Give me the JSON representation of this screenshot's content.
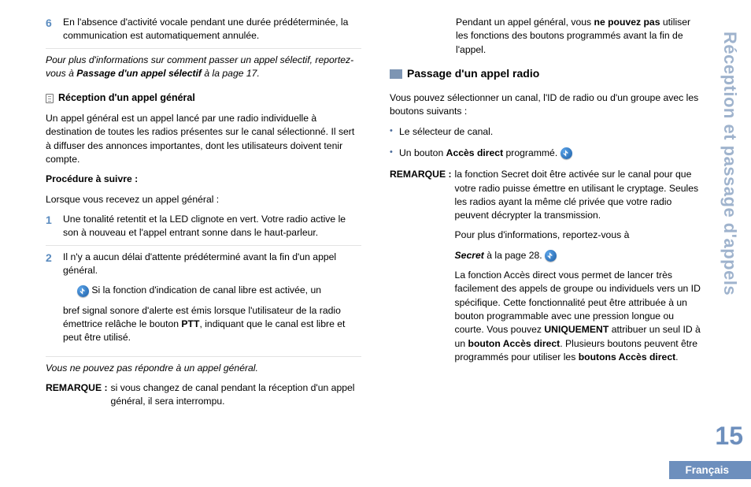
{
  "left": {
    "step6": {
      "num": "6",
      "text": "En l'absence d'activité vocale pendant une durée prédéterminée, la communication est automatiquement annulée."
    },
    "selective_note_pre": "Pour plus d'informations sur comment passer un appel sélectif, reportez-vous à ",
    "selective_note_bold": "Passage d'un appel sélectif",
    "selective_note_post": " à la page 17.",
    "reception_heading": "Réception d'un appel général",
    "reception_para": "Un appel général est un appel lancé par une radio individuelle à destination de toutes les radios présentes sur le canal sélectionné. Il sert à diffuser des annonces importantes, dont les utilisateurs doivent tenir compte.",
    "procedure_label": "Procédure à suivre :",
    "procedure_intro": "Lorsque vous recevez un appel général :",
    "step1": {
      "num": "1",
      "text": "Une tonalité retentit et la LED clignote en vert. Votre radio active le son à nouveau et l'appel entrant sonne dans le haut-parleur."
    },
    "step2": {
      "num": "2",
      "line1": "Il n'y a aucun délai d'attente prédéterminé avant la fin d'un appel général.",
      "line2_pre": " Si la fonction d'indication de canal libre est activée, un",
      "line3": "bref signal sonore d'alerte est émis lorsque l'utilisateur de la radio émettrice relâche le bouton ",
      "line3_bold": "PTT",
      "line3_post": ", indiquant que le canal est libre et peut être utilisé."
    },
    "cannot_answer": "Vous ne pouvez pas répondre à un appel général.",
    "remarque_label": "REMARQUE :",
    "remarque_body": "si vous changez de canal pendant la réception d'un appel général, il sera interrompu."
  },
  "right": {
    "top_para_pre": "Pendant un appel général, vous ",
    "top_para_bold": "ne pouvez pas",
    "top_para_post": " utiliser les fonctions des boutons programmés avant la fin de l'appel.",
    "section_title": "Passage d'un appel radio",
    "intro": "Vous pouvez sélectionner un canal, l'ID de radio ou d'un groupe avec les boutons suivants :",
    "bullet1": "Le sélecteur de canal.",
    "bullet2_pre": "Un bouton ",
    "bullet2_bold": "Accès direct",
    "bullet2_post": " programmé.  ",
    "remarque_label": "REMARQUE :",
    "r_para1": "la fonction Secret doit être activée sur le canal pour que votre radio puisse émettre en utilisant le cryptage. Seules les radios ayant la même clé privée que votre radio peuvent décrypter la transmission.",
    "r_para2": "Pour plus d'informations, reportez-vous à",
    "r_secret_bold": "Secret",
    "r_secret_post": " à la page 28.  ",
    "r_para3a": "La fonction Accès direct vous permet de lancer très facilement des appels de groupe ou individuels vers un ID spécifique. Cette fonctionnalité peut être attribuée à un bouton programmable avec une pression longue ou courte. Vous pouvez ",
    "r_para3_unique": "UNIQUEMENT",
    "r_para3b": " attribuer un seul ID à un ",
    "r_para3_bold2": "bouton Accès direct",
    "r_para3c": ". Plusieurs boutons peuvent être programmés pour utiliser les ",
    "r_para3_bold3": "boutons Accès direct",
    "r_para3d": "."
  },
  "side": {
    "chapter": "Réception et passage d'appels",
    "page": "15",
    "lang": "Français"
  }
}
